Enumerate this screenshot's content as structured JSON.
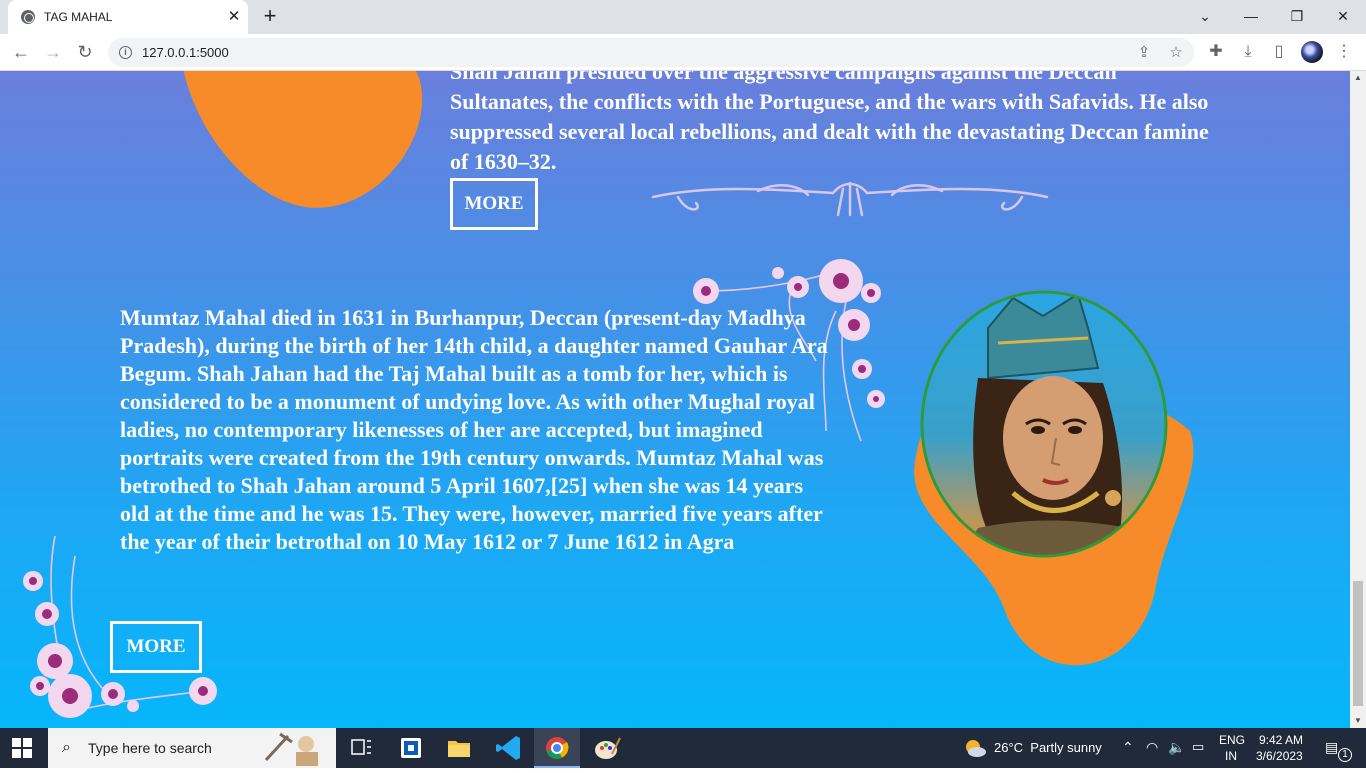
{
  "browser": {
    "tab_title": "TAG MAHAL",
    "tab_close": "✕",
    "new_tab": "+",
    "url": "127.0.0.1:5000",
    "win_dropdown": "⌄",
    "win_minimize": "—",
    "win_restore": "❐",
    "win_close": "✕",
    "back": "←",
    "forward": "→",
    "reload": "↻"
  },
  "page": {
    "top_paragraph": "Shah Jahan presided over the aggressive campaigns against the Deccan Sultanates, the conflicts with the Portuguese, and the wars with Safavids. He also suppressed several local rebellions, and dealt with the devastating Deccan famine of 1630–32.",
    "more_button_1": "MORE",
    "mid_paragraph": "Mumtaz Mahal died in 1631 in Burhanpur, Deccan (present-day Madhya Pradesh), during the birth of her 14th child, a daughter named Gauhar Ara Begum. Shah Jahan had the Taj Mahal built as a tomb for her, which is considered to be a monument of undying love. As with other Mughal royal ladies, no contemporary likenesses of her are accepted, but imagined portraits were created from the 19th century onwards. Mumtaz Mahal was betrothed to Shah Jahan around 5 April 1607,[25] when she was 14 years old at the time and he was 15. They were, however, married five years after the year of their betrothal on 10 May 1612 or 7 June 1612 in Agra",
    "more_button_2": "MORE",
    "colors": {
      "blob": "#f78b2a",
      "portrait_ring": "#2e9b3a"
    }
  },
  "taskbar": {
    "search_placeholder": "Type here to search",
    "weather": "26°C  Partly sunny",
    "language_top": "ENG",
    "language_bottom": "IN",
    "time": "9:42 AM",
    "date": "3/6/2023",
    "notification_count": "1"
  }
}
